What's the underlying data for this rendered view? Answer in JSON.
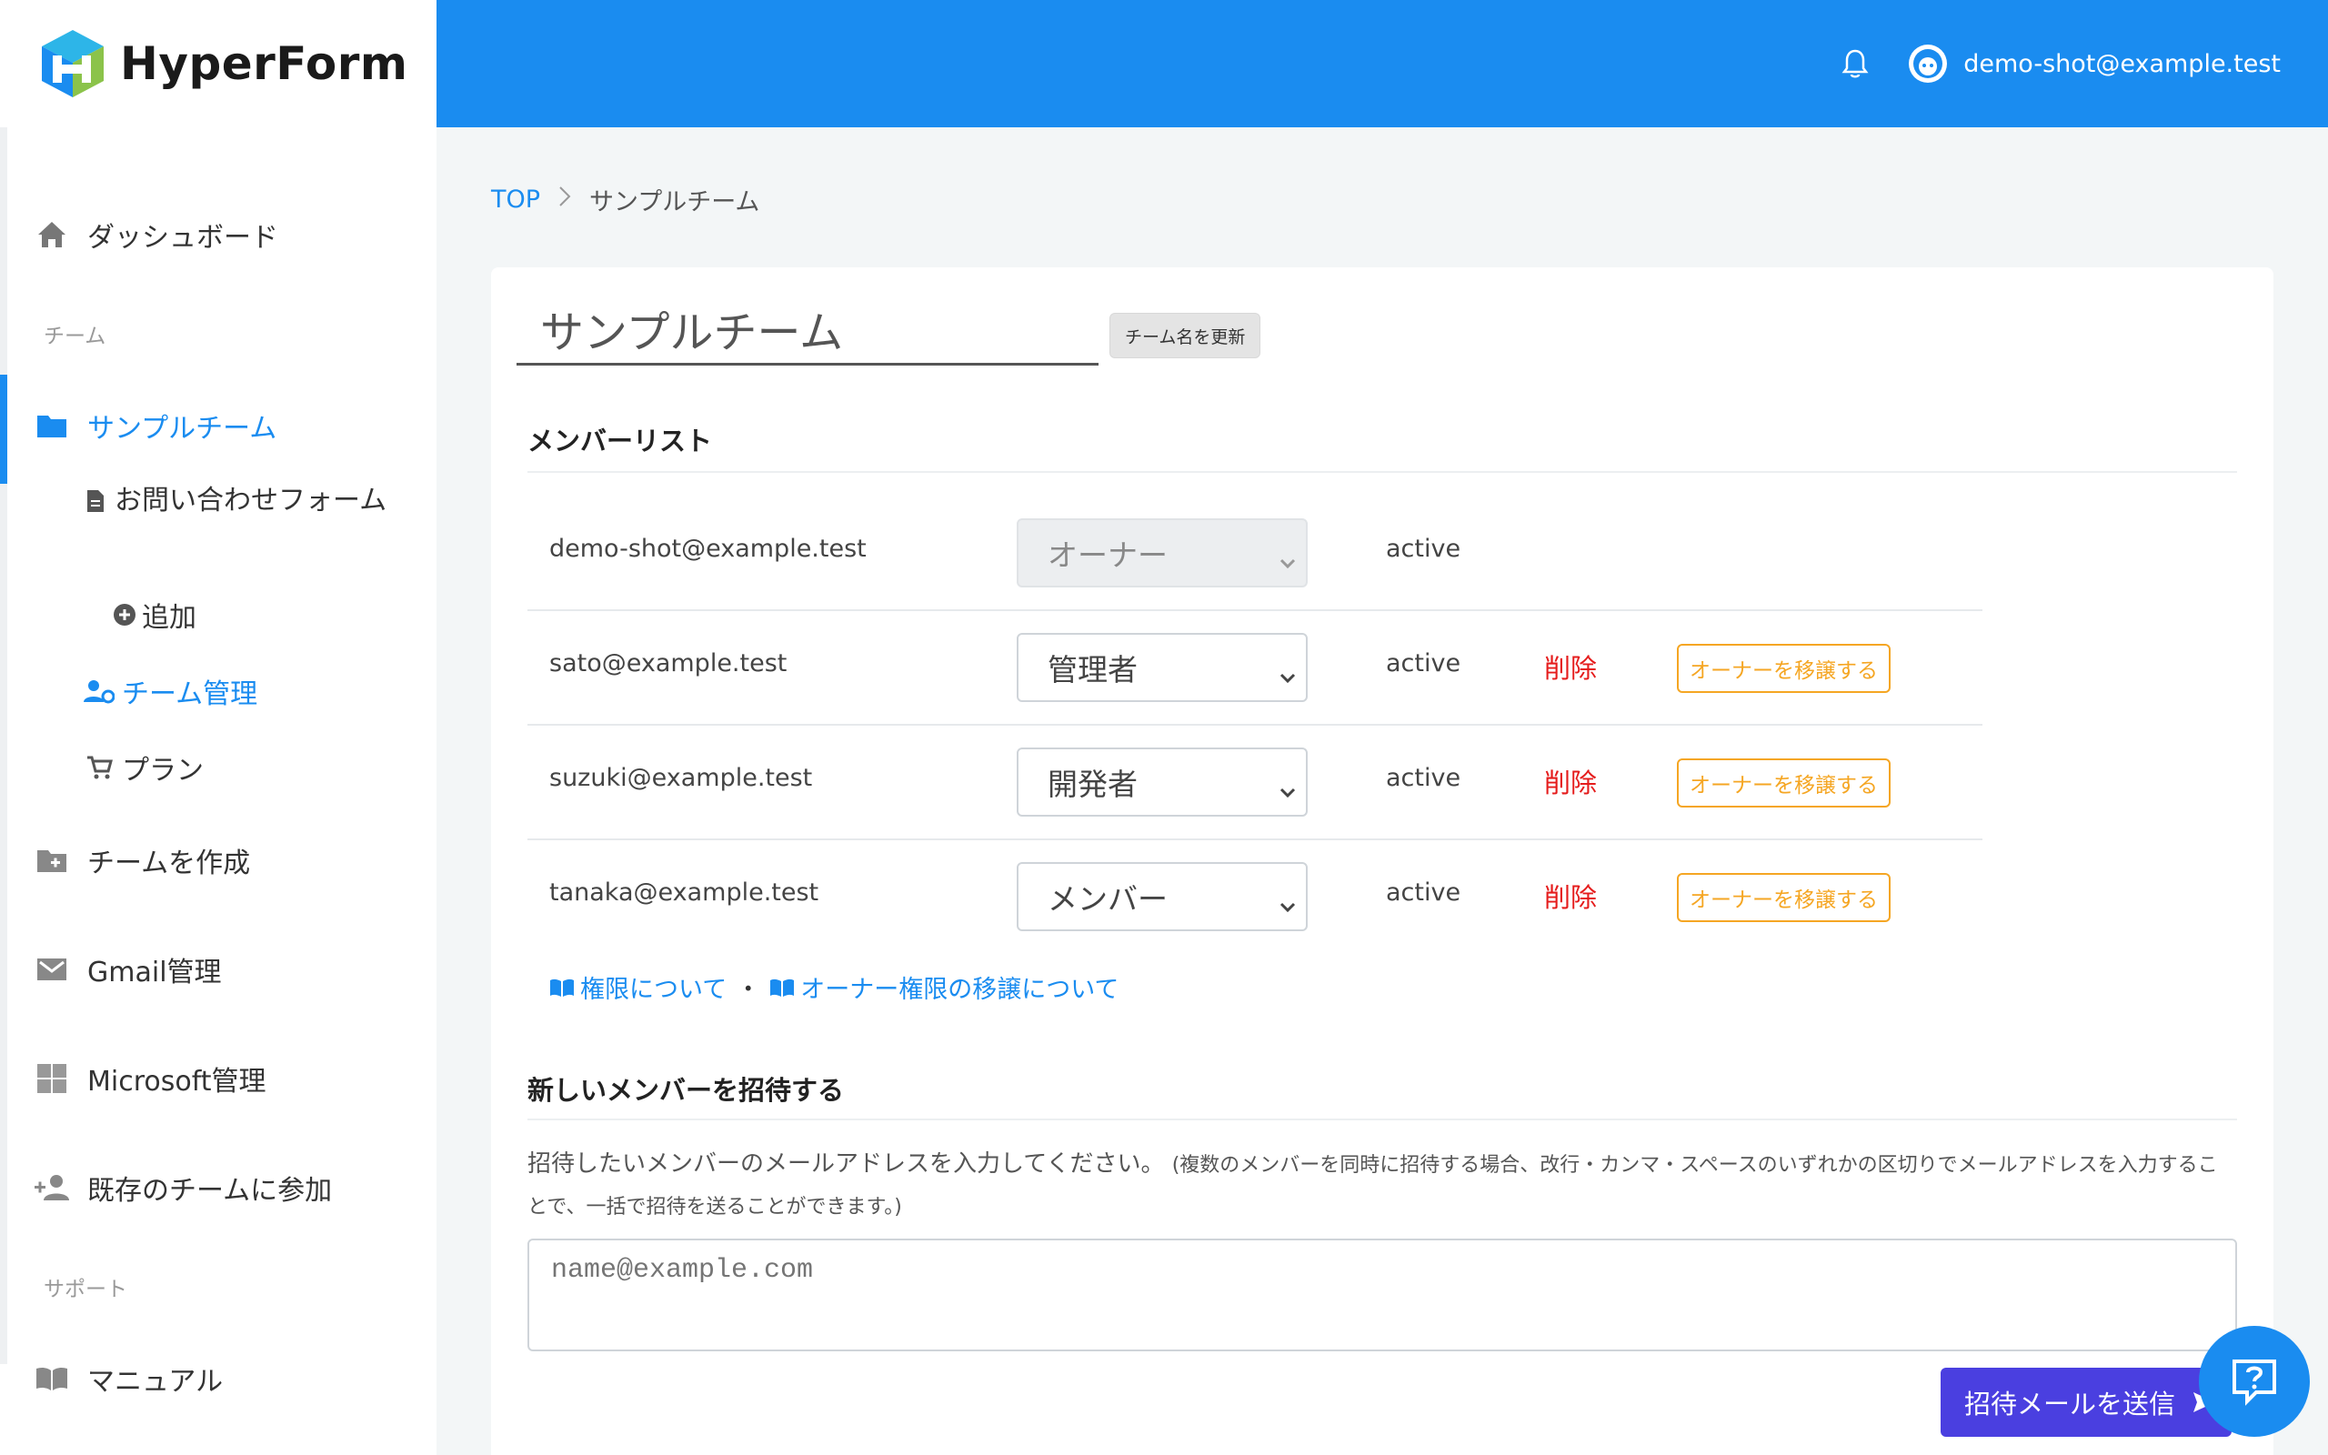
{
  "app": {
    "brand": "HyperForm"
  },
  "header": {
    "user_email": "demo-shot@example.test"
  },
  "sidebar": {
    "dashboard": "ダッシュボード",
    "team_section": "チーム",
    "team_name": "サンプルチーム",
    "form_item": "お問い合わせフォーム",
    "add": "追加",
    "team_manage": "チーム管理",
    "plan": "プラン",
    "create_team": "チームを作成",
    "gmail": "Gmail管理",
    "microsoft": "Microsoft管理",
    "join_team": "既存のチームに参加",
    "support_section": "サポート",
    "manual": "マニュアル"
  },
  "breadcrumb": {
    "top": "TOP",
    "current": "サンプルチーム"
  },
  "team": {
    "name_value": "サンプルチーム",
    "update_button": "チーム名を更新"
  },
  "members": {
    "title": "メンバーリスト",
    "delete_label": "削除",
    "transfer_label": "オーナーを移譲する",
    "rows": [
      {
        "email": "demo-shot@example.test",
        "role": "オーナー",
        "status": "active"
      },
      {
        "email": "sato@example.test",
        "role": "管理者",
        "status": "active"
      },
      {
        "email": "suzuki@example.test",
        "role": "開発者",
        "status": "active"
      },
      {
        "email": "tanaka@example.test",
        "role": "メンバー",
        "status": "active"
      }
    ]
  },
  "help_links": {
    "permissions": "権限について",
    "separator": "・",
    "owner_transfer": "オーナー権限の移譲について"
  },
  "invite": {
    "title": "新しいメンバーを招待する",
    "description": "招待したいメンバーのメールアドレスを入力してください。",
    "description_note": "(複数のメンバーを同時に招待する場合、改行・カンマ・スペースのいずれかの区切りでメールアドレスを入力することで、一括で招待を送ることができます。)",
    "placeholder": "name@example.com",
    "send_button": "招待メールを送信"
  }
}
